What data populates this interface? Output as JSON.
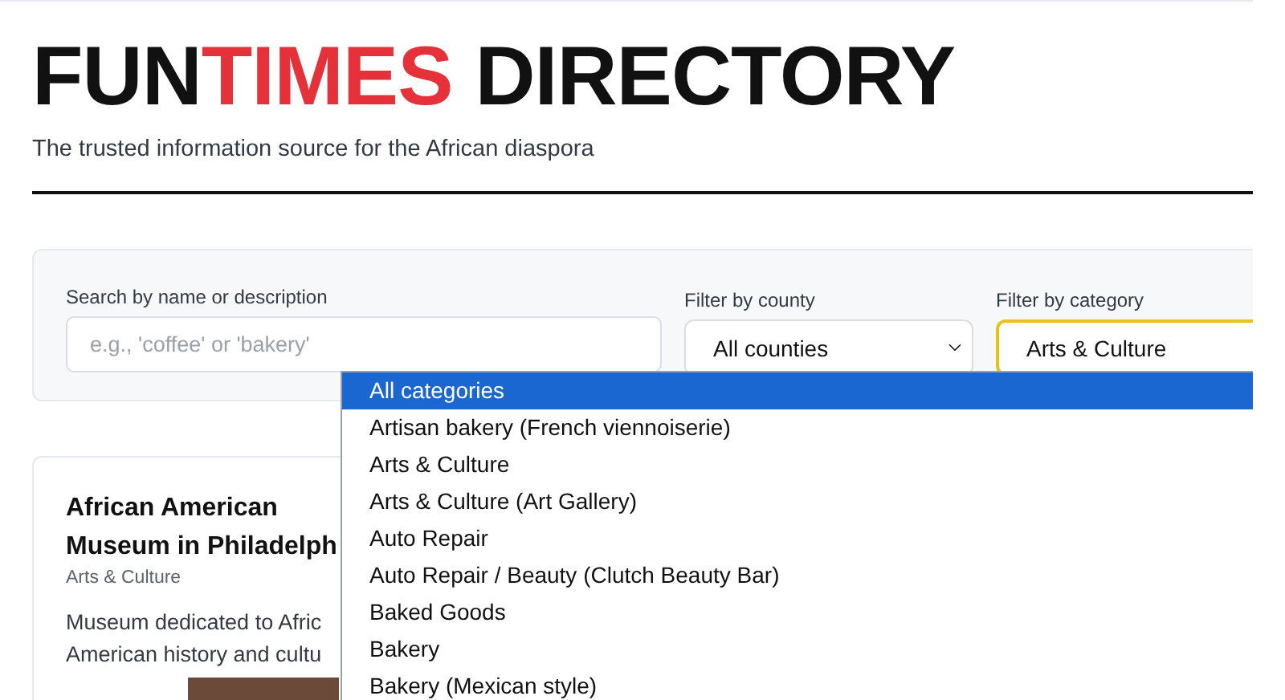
{
  "header": {
    "title_parts": [
      {
        "text": "FUN",
        "accent": false
      },
      {
        "text": "TIMES",
        "accent": true
      },
      {
        "text": " DIRECTORY",
        "accent": false
      }
    ],
    "subtitle": "The trusted information source for the African diaspora"
  },
  "filters": {
    "search": {
      "label": "Search by name or description",
      "placeholder": "e.g., 'coffee' or 'bakery'"
    },
    "county": {
      "label": "Filter by county",
      "value": "All counties",
      "focused": false
    },
    "category": {
      "label": "Filter by category",
      "value": "Arts & Culture",
      "focused": true,
      "expanded": true,
      "options": [
        {
          "label": "All categories",
          "highlighted": true
        },
        {
          "label": "Artisan bakery (French viennoiserie)",
          "highlighted": false
        },
        {
          "label": "Arts & Culture",
          "highlighted": false
        },
        {
          "label": "Arts & Culture (Art Gallery)",
          "highlighted": false
        },
        {
          "label": "Auto Repair",
          "highlighted": false
        },
        {
          "label": "Auto Repair / Beauty (Clutch Beauty Bar)",
          "highlighted": false
        },
        {
          "label": "Baked Goods",
          "highlighted": false
        },
        {
          "label": "Bakery",
          "highlighted": false
        },
        {
          "label": "Bakery (Mexican style)",
          "highlighted": false
        }
      ]
    }
  },
  "listings": [
    {
      "title_lines": [
        "African American",
        "Museum in Philadelph"
      ],
      "category": "Arts & Culture",
      "description_lines": [
        "Museum dedicated to Afric",
        "American history and cultu"
      ]
    }
  ]
}
